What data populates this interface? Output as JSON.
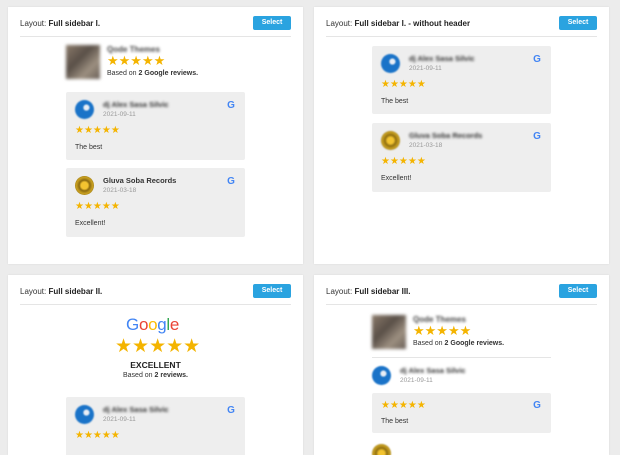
{
  "panels": [
    {
      "layout_prefix": "Layout:",
      "layout_name": "Full sidebar I.",
      "select_label": "Select"
    },
    {
      "layout_prefix": "Layout:",
      "layout_name": "Full sidebar I. - without header",
      "select_label": "Select"
    },
    {
      "layout_prefix": "Layout:",
      "layout_name": "Full sidebar II.",
      "select_label": "Select"
    },
    {
      "layout_prefix": "Layout:",
      "layout_name": "Full sidebar III.",
      "select_label": "Select"
    }
  ],
  "summary": {
    "business_name": "Qode Themes",
    "stars": "★★★★★",
    "based_on_prefix": "Based on",
    "based_on_count": "2 Google reviews."
  },
  "reviews": [
    {
      "name": "dj Alex Sasa Silvic",
      "date": "2021-09-11",
      "stars": "★★★★★",
      "text": "The best"
    },
    {
      "name": "Gluva Soba Records",
      "date": "2021-03-18",
      "stars": "★★★★★",
      "text": "Excellent!"
    }
  ],
  "badge": {
    "google_letters": [
      "G",
      "o",
      "o",
      "g",
      "l",
      "e"
    ],
    "google_colors": [
      "#4285F4",
      "#EA4335",
      "#FBBC05",
      "#4285F4",
      "#34A853",
      "#EA4335"
    ],
    "stars": "★★★★★",
    "rating_word": "EXCELLENT",
    "based_prefix": "Based on",
    "based_count": "2 reviews."
  },
  "icons": {
    "google": "google-g-icon",
    "star": "star-icon"
  },
  "colors": {
    "accent": "#2aa3e0",
    "star": "#f4b400",
    "card_bg": "#eeeeee",
    "page_bg": "#ececec"
  }
}
